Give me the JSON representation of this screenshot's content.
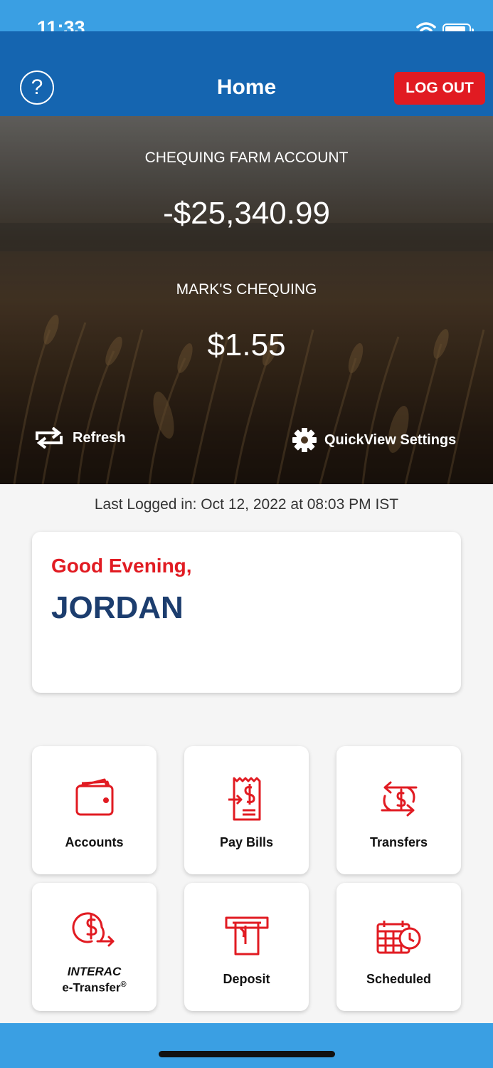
{
  "status_bar": {
    "time": "11:33"
  },
  "header": {
    "title": "Home",
    "help_symbol": "?",
    "logout_label": "LOG OUT"
  },
  "quickview": {
    "accounts": [
      {
        "name": "CHEQUING FARM ACCOUNT",
        "balance": "-$25,340.99"
      },
      {
        "name": "MARK'S CHEQUING",
        "balance": "$1.55"
      }
    ],
    "refresh_label": "Refresh",
    "settings_label": "QuickView Settings"
  },
  "last_login": "Last Logged in: Oct 12, 2022 at 08:03 PM  IST",
  "greeting": {
    "salutation": "Good Evening,",
    "name": "JORDAN"
  },
  "tiles": {
    "accounts": "Accounts",
    "pay_bills": "Pay Bills",
    "transfers": "Transfers",
    "interac_line1": "INTERAC",
    "interac_line2": "e-Transfer",
    "interac_mark": "®",
    "deposit": "Deposit",
    "scheduled": "Scheduled"
  },
  "colors": {
    "status_bar": "#3a9fe3",
    "header": "#1565b0",
    "logout": "#e11b22",
    "greeting_red": "#e11b22",
    "name_navy": "#1c3d6e",
    "icon_red": "#e11b22"
  },
  "icons": {
    "help": "question-circle-icon",
    "refresh": "refresh-icon",
    "settings": "gear-icon",
    "accounts": "wallet-icon",
    "pay_bills": "receipt-dollar-icon",
    "transfers": "transfer-dollar-icon",
    "interac": "dollar-send-icon",
    "deposit": "atm-deposit-icon",
    "scheduled": "calendar-clock-icon"
  }
}
